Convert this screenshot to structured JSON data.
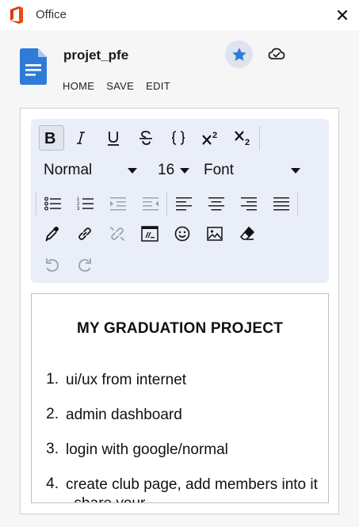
{
  "window": {
    "app_name": "Office",
    "logo_icon": "office-logo",
    "close_icon": "close-icon"
  },
  "document": {
    "name": "projet_pfe",
    "starred": true,
    "accent_color": "#2f7bd8"
  },
  "menu": {
    "items": [
      "HOME",
      "SAVE",
      "EDIT"
    ]
  },
  "toolbar": {
    "format_buttons": [
      "bold-icon",
      "italic-icon",
      "underline-icon",
      "strikethrough-icon",
      "code-icon",
      "superscript-icon",
      "subscript-icon"
    ],
    "style_select": "Normal",
    "size_select": "16",
    "font_select": "Font",
    "list_buttons": [
      "bullet-list-icon",
      "numbered-list-icon",
      "indent-icon",
      "outdent-icon",
      "align-left-icon",
      "align-center-icon",
      "align-right-icon",
      "align-justify-icon"
    ],
    "insert_buttons": [
      "color-picker-icon",
      "link-icon",
      "unlink-icon",
      "code-block-icon",
      "emoji-icon",
      "image-icon",
      "eraser-icon"
    ],
    "history_buttons": [
      "undo-icon",
      "redo-icon"
    ]
  },
  "content": {
    "heading": "MY GRADUATION PROJECT",
    "items": [
      {
        "num": "1.",
        "text": "ui/ux from internet"
      },
      {
        "num": "2.",
        "text": "admin dashboard"
      },
      {
        "num": "3.",
        "text": "login with google/normal"
      },
      {
        "num": "4.",
        "text": "create club page, add members into it , share your"
      }
    ]
  }
}
